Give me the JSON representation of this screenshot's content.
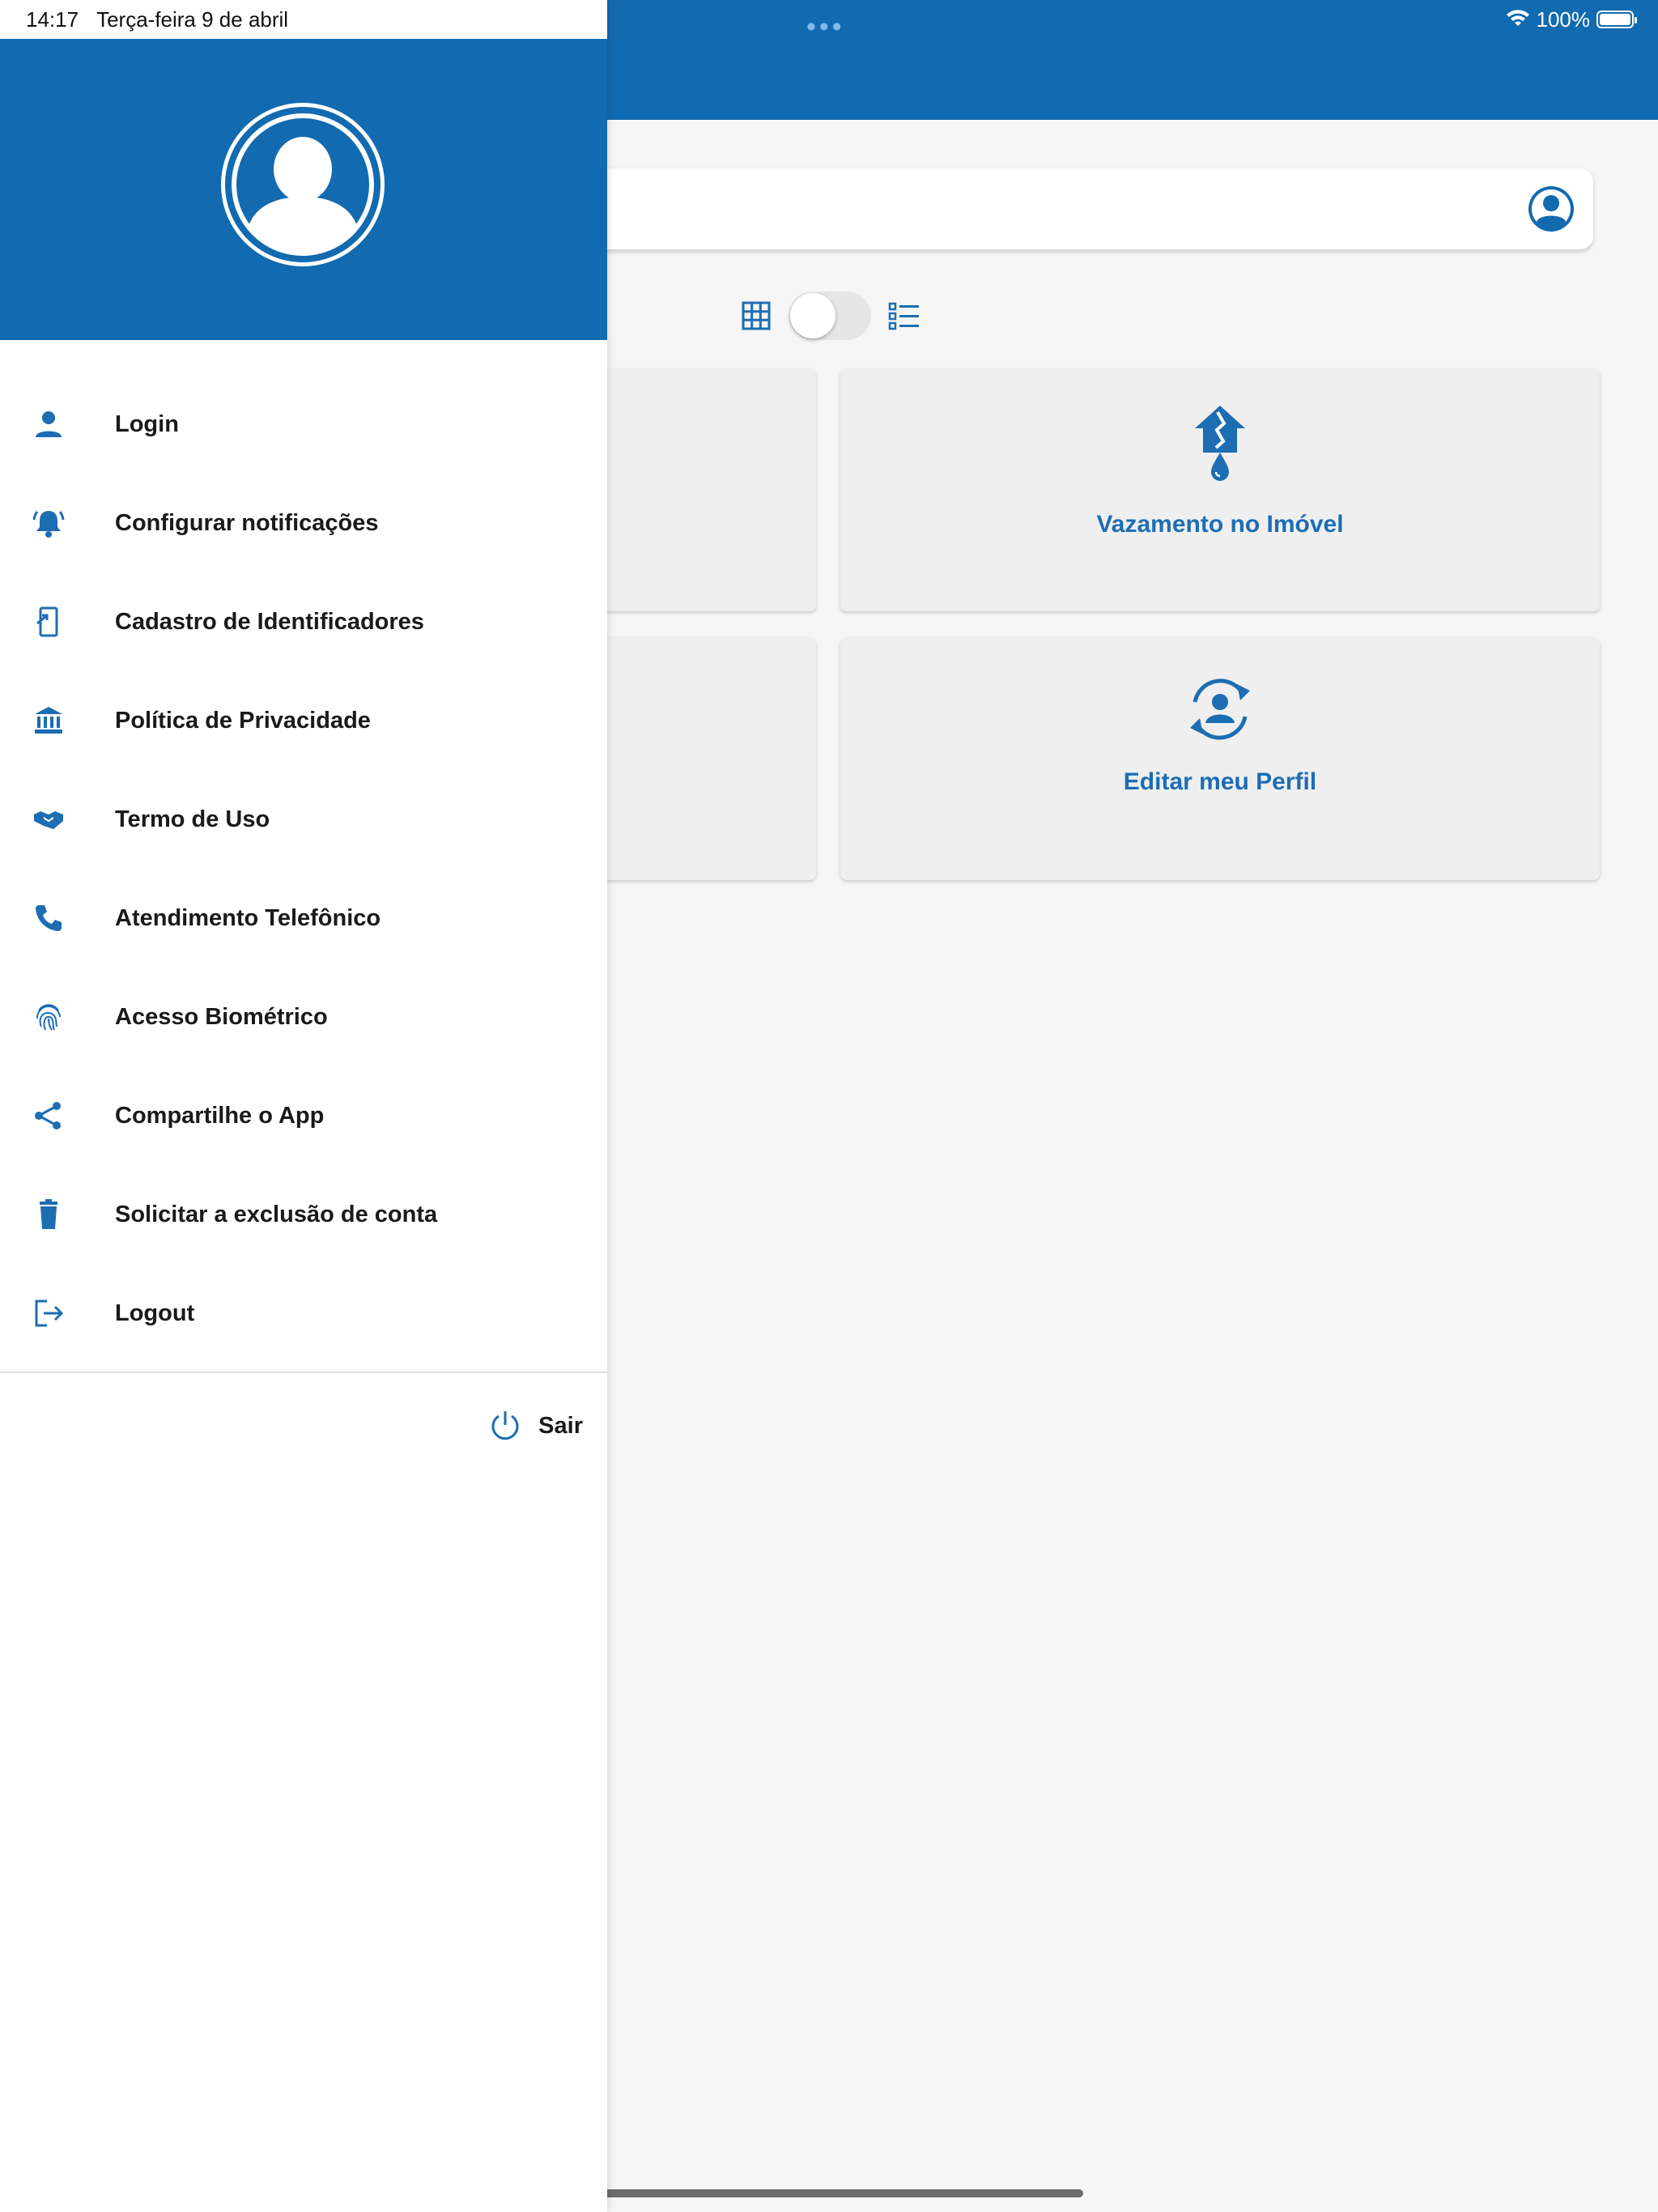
{
  "status_bar": {
    "time": "14:17",
    "date": "Terça-feira 9 de abril",
    "battery": "100%",
    "dots": "•••"
  },
  "colors": {
    "primary": "#126ab0",
    "text": "#1a1a1a",
    "card_label": "#1d6db3",
    "card_bg": "#efefef"
  },
  "drawer": {
    "menu": [
      {
        "label": "Login",
        "icon": "person-icon"
      },
      {
        "label": "Configurar notificações",
        "icon": "bell-alert-icon"
      },
      {
        "label": "Cadastro de Identificadores",
        "icon": "phone-link-icon"
      },
      {
        "label": "Política de Privacidade",
        "icon": "bank-icon"
      },
      {
        "label": "Termo de Uso",
        "icon": "handshake-icon"
      },
      {
        "label": "Atendimento Telefônico",
        "icon": "phone-icon"
      },
      {
        "label": "Acesso Biométrico",
        "icon": "fingerprint-icon"
      },
      {
        "label": "Compartilhe o App",
        "icon": "share-icon"
      },
      {
        "label": "Solicitar a exclusão de conta",
        "icon": "trash-icon"
      },
      {
        "label": "Logout",
        "icon": "logout-icon"
      }
    ],
    "exit_label": "Sair"
  },
  "main": {
    "view_toggle": {
      "mode": "grid",
      "grid_icon": "grid-icon",
      "list_icon": "list-icon"
    },
    "cards": [
      {
        "label": "Vazamento no Imóvel",
        "icon": "house-leak-icon"
      },
      {
        "label": "Editar meu Perfil",
        "icon": "profile-sync-icon"
      }
    ]
  }
}
